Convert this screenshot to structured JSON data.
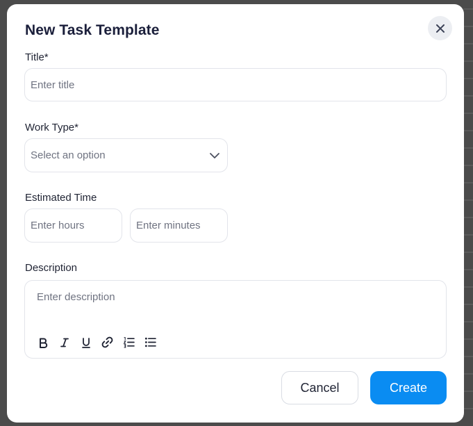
{
  "dialog": {
    "title": "New Task Template",
    "close_icon": "close-icon"
  },
  "fields": {
    "title": {
      "label": "Title*",
      "placeholder": "Enter title",
      "value": ""
    },
    "work_type": {
      "label": "Work Type*",
      "selected": "Select an option",
      "icon": "chevron-down-icon"
    },
    "estimated_time": {
      "label": "Estimated Time",
      "hours_placeholder": "Enter hours",
      "minutes_placeholder": "Enter minutes"
    },
    "description": {
      "label": "Description",
      "placeholder": "Enter description",
      "toolbar": [
        "bold-icon",
        "italic-icon",
        "underline-icon",
        "link-icon",
        "ordered-list-icon",
        "bullet-list-icon"
      ]
    }
  },
  "actions": {
    "cancel_label": "Cancel",
    "create_label": "Create"
  },
  "colors": {
    "primary": "#0a8cf2",
    "backdrop": "#4b4b4b",
    "title": "#1b1f3b",
    "placeholder": "#6f7381",
    "border": "#e2e4ea"
  }
}
